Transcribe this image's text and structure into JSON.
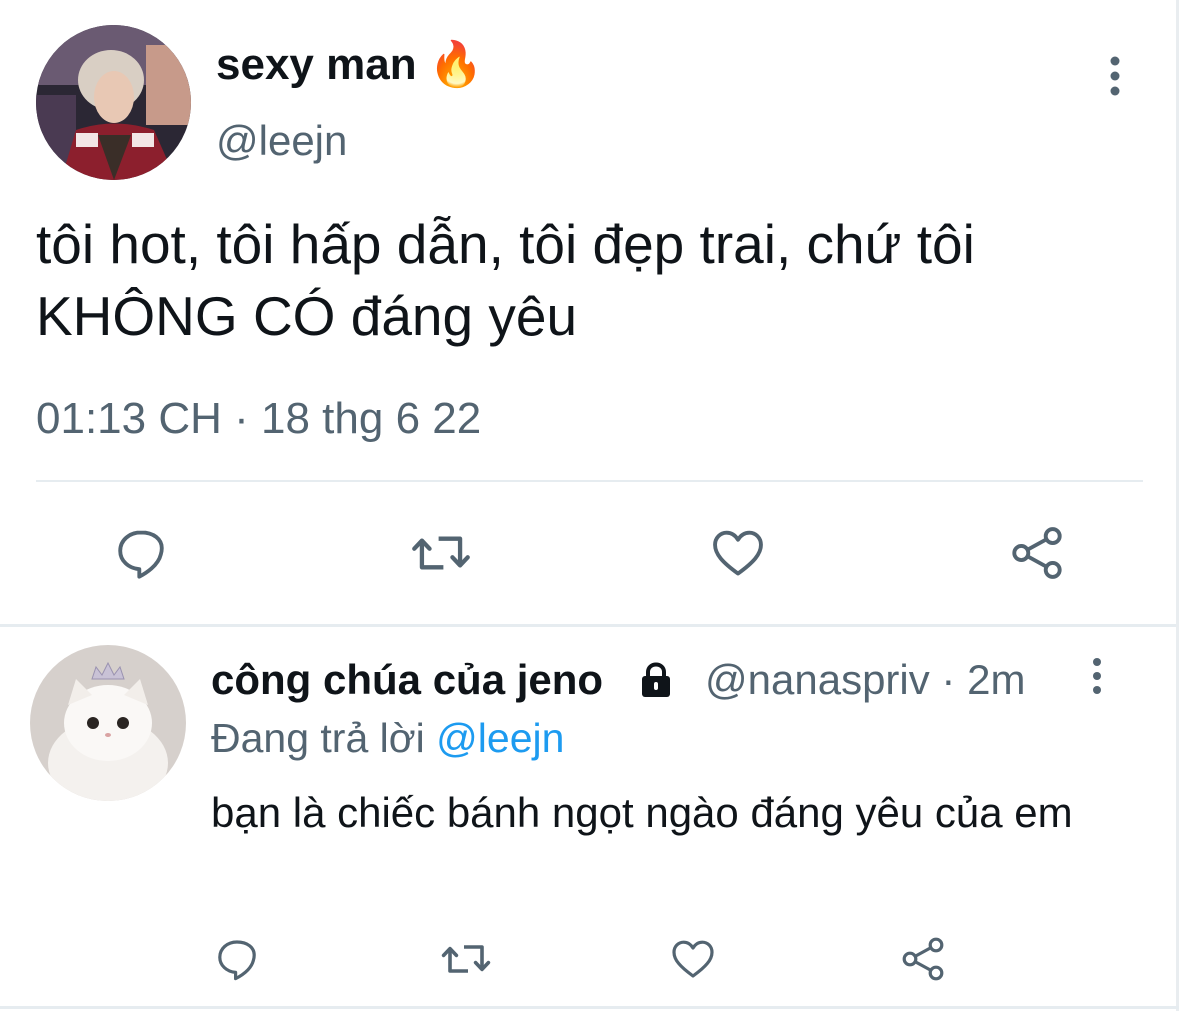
{
  "tweet": {
    "display_name": "sexy man",
    "name_emoji": "🔥",
    "handle": "@leejn",
    "text": "tôi hot, tôi hấp dẫn, tôi đẹp trai, chứ tôi KHÔNG CÓ đáng yêu",
    "time": "01:13 CH",
    "separator": "·",
    "date": "18 thg 6 22",
    "avatar_icon": "person-photo",
    "more_icon": "more-vertical-icon"
  },
  "actions": {
    "reply_icon": "reply-icon",
    "retweet_icon": "retweet-icon",
    "like_icon": "heart-icon",
    "share_icon": "share-icon"
  },
  "reply": {
    "display_name": "công chúa của jeno",
    "lock_icon": "lock-icon",
    "handle": "@nanaspriv",
    "separator": "·",
    "age": "2m",
    "replying_prefix": "Đang trả lời",
    "replying_to": "@leejn",
    "text": "bạn là chiếc bánh ngọt ngào đáng yêu của em",
    "avatar_icon": "cat-photo"
  },
  "colors": {
    "text": "#0f1419",
    "secondary": "#536471",
    "link": "#1d9bf0",
    "divider": "#e6ecf0"
  }
}
